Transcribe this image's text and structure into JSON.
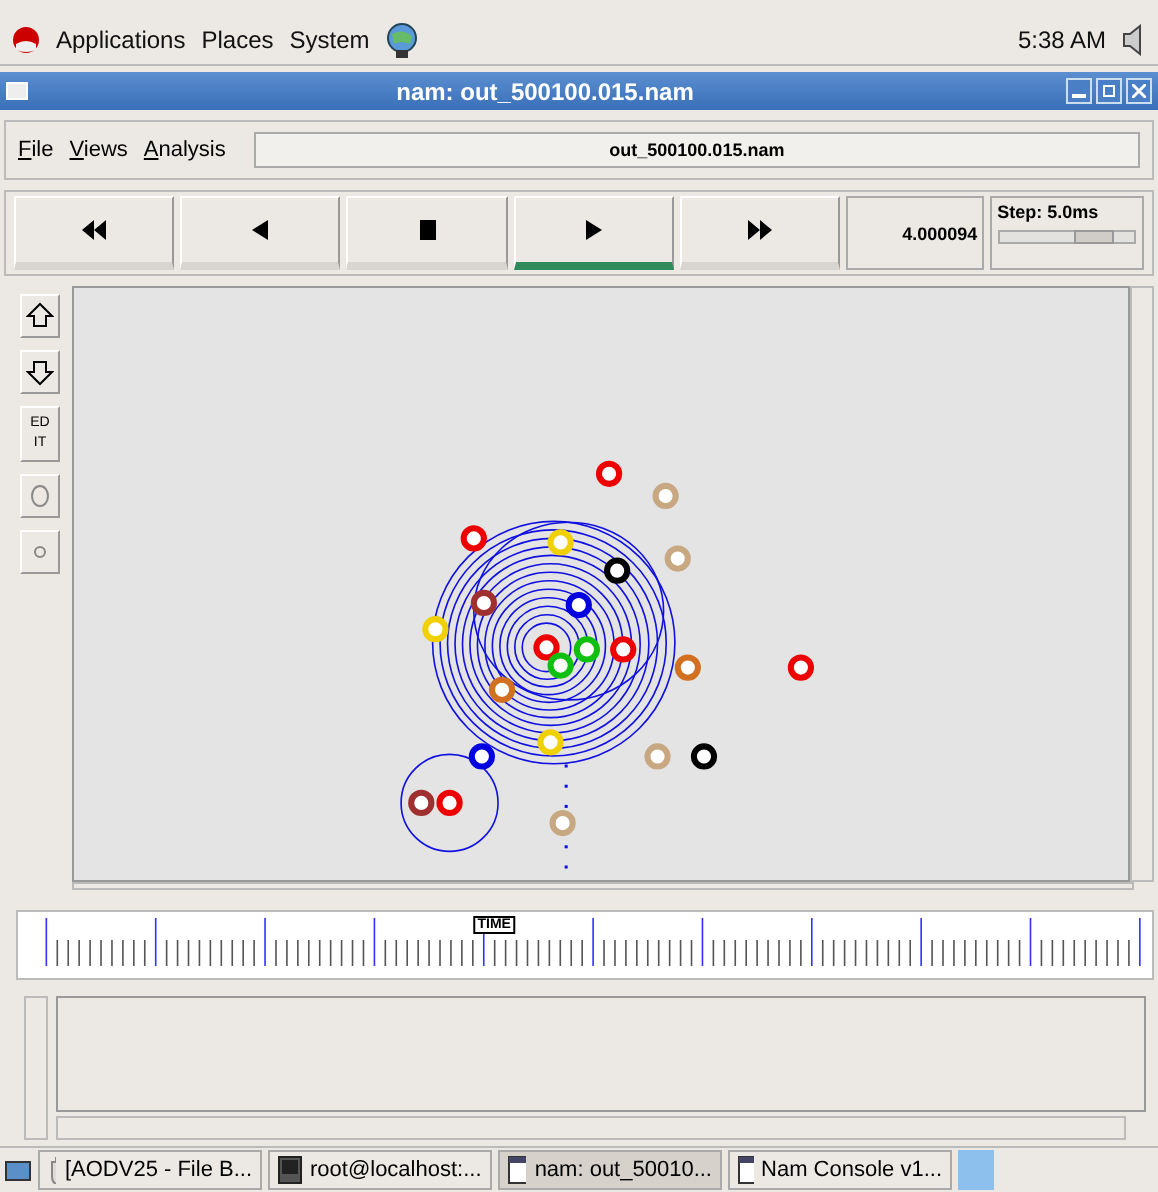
{
  "top_panel": {
    "menus": [
      "Applications",
      "Places",
      "System"
    ],
    "clock": "5:38 AM"
  },
  "window": {
    "title": "nam: out_500100.015.nam"
  },
  "menu": [
    "File",
    "Views",
    "Analysis"
  ],
  "file_label": "out_500100.015.nam",
  "controls": [
    {
      "kind": "rewind",
      "selected": false
    },
    {
      "kind": "back",
      "selected": false
    },
    {
      "kind": "stop",
      "selected": false
    },
    {
      "kind": "play",
      "selected": true
    },
    {
      "kind": "forward",
      "selected": false
    }
  ],
  "time": "4.000094",
  "step": {
    "label": "Step: 5.0ms",
    "level": 0.7
  },
  "tools": [
    {
      "kind": "up"
    },
    {
      "kind": "down"
    },
    {
      "kind": "edit",
      "label": "EDIT"
    },
    {
      "kind": "circle"
    },
    {
      "kind": "dot"
    }
  ],
  "timeline": {
    "label": "TIME",
    "level": 0.42
  },
  "taskbar": [
    {
      "kind": "folder",
      "label": "[AODV25 - File B...",
      "selected": false
    },
    {
      "kind": "terminal",
      "label": "root@localhost:...",
      "selected": false
    },
    {
      "kind": "window",
      "label": "nam: out_50010...",
      "selected": true
    },
    {
      "kind": "window",
      "label": "Nam Console v1...",
      "selected": false
    }
  ]
}
